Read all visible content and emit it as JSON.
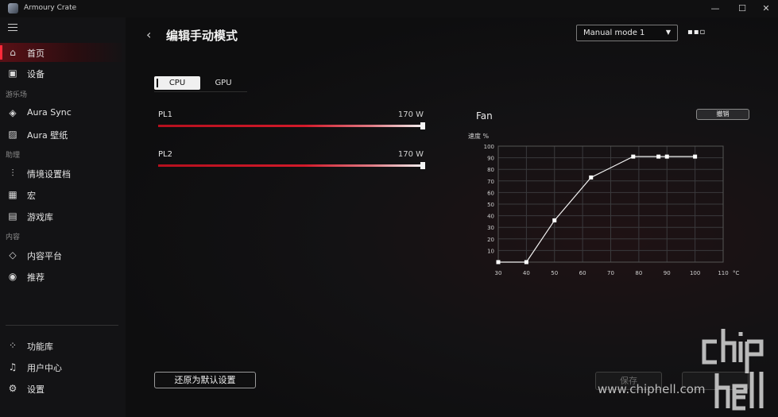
{
  "app": {
    "title": "Armoury Crate"
  },
  "window": {
    "minimize": "—",
    "maximize": "☐",
    "close": "✕"
  },
  "sidebar": {
    "sections": {
      "play": "游乐场",
      "assist": "助理",
      "content": "内容"
    },
    "items": [
      {
        "label": "首页",
        "icon": "home-icon",
        "active": true
      },
      {
        "label": "设备",
        "icon": "device-icon"
      },
      {
        "label": "Aura Sync",
        "icon": "aura-icon"
      },
      {
        "label": "Aura 壁纸",
        "icon": "wallpaper-icon"
      },
      {
        "label": "情境设置档",
        "icon": "sliders-icon"
      },
      {
        "label": "宏",
        "icon": "macro-icon"
      },
      {
        "label": "游戏库",
        "icon": "game-library-icon"
      },
      {
        "label": "内容平台",
        "icon": "layers-icon"
      },
      {
        "label": "推荐",
        "icon": "badge-icon"
      },
      {
        "label": "功能库",
        "icon": "feature-library-icon"
      },
      {
        "label": "用户中心",
        "icon": "bell-icon"
      },
      {
        "label": "设置",
        "icon": "gear-icon"
      }
    ]
  },
  "header": {
    "title": "编辑手动模式",
    "mode_select": "Manual mode 1"
  },
  "tabs": {
    "cpu": "CPU",
    "gpu": "GPU",
    "selected": "CPU"
  },
  "sliders": [
    {
      "label": "PL1",
      "value": "170 W",
      "level": 1.0
    },
    {
      "label": "PL2",
      "value": "170 W",
      "level": 1.0
    }
  ],
  "fan": {
    "title": "Fan",
    "undo_label": "撤销"
  },
  "chart_data": {
    "type": "line",
    "ylabel": "速度 %",
    "xunit": "°C",
    "x_ticks": [
      30,
      40,
      50,
      60,
      70,
      80,
      90,
      100,
      110
    ],
    "y_ticks": [
      10,
      20,
      30,
      40,
      50,
      60,
      70,
      80,
      90,
      100
    ],
    "xlim": [
      30,
      110
    ],
    "ylim": [
      0,
      100
    ],
    "grid": true,
    "points": [
      {
        "x": 30,
        "y": 0
      },
      {
        "x": 40,
        "y": 0
      },
      {
        "x": 50,
        "y": 36
      },
      {
        "x": 63,
        "y": 73
      },
      {
        "x": 78,
        "y": 91
      },
      {
        "x": 87,
        "y": 91
      },
      {
        "x": 90,
        "y": 91
      },
      {
        "x": 100,
        "y": 91
      }
    ]
  },
  "footer": {
    "reset_label": "还原为默认设置",
    "save_label": "保存"
  },
  "watermark": {
    "url": "www.chiphell.com",
    "logo_text": "chip hell"
  },
  "colors": {
    "accent": "#d21a2a",
    "active_bar": "#ff2a3a"
  }
}
